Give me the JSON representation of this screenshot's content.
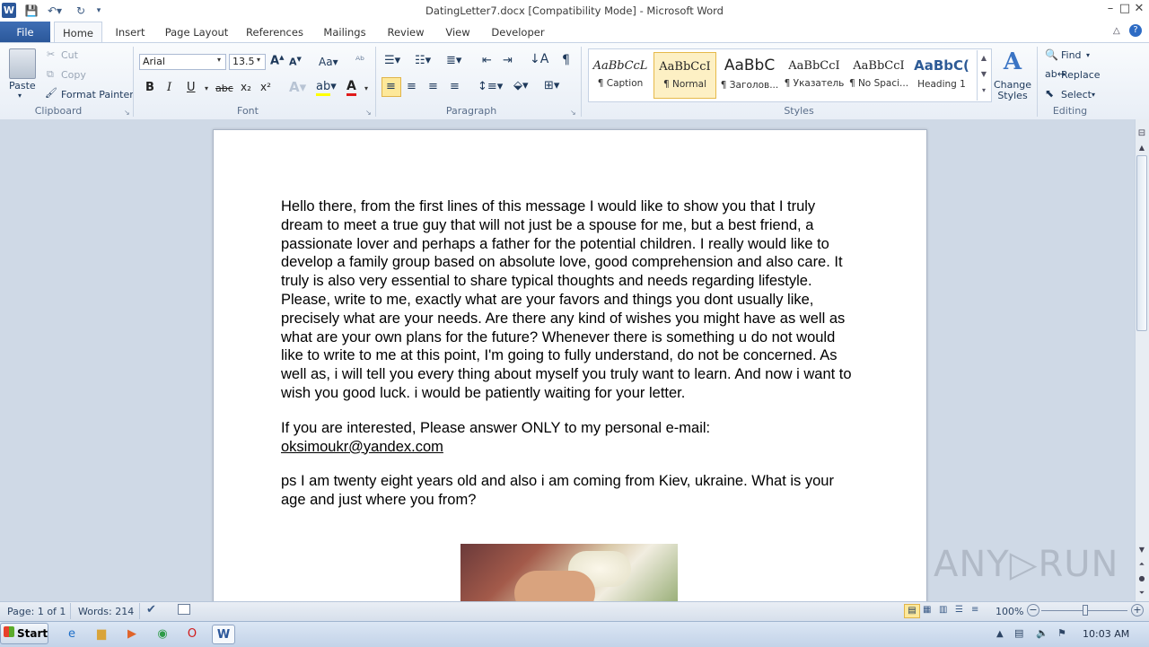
{
  "window": {
    "title": "DatingLetter7.docx [Compatibility Mode] - Microsoft Word",
    "controls": {
      "minimize": "–",
      "maximize": "□",
      "close": "✕"
    }
  },
  "tabs": [
    "File",
    "Home",
    "Insert",
    "Page Layout",
    "References",
    "Mailings",
    "Review",
    "View",
    "Developer"
  ],
  "ribbon": {
    "clipboard": {
      "paste": "Paste",
      "cut": "Cut",
      "copy": "Copy",
      "format_painter": "Format Painter",
      "label": "Clipboard"
    },
    "font": {
      "name": "Arial",
      "size": "13.5",
      "label": "Font",
      "bold": "B",
      "italic": "I",
      "underline": "U",
      "strike": "abc",
      "subscript": "x₂",
      "superscript": "x²",
      "font_color": "A"
    },
    "paragraph": {
      "label": "Paragraph",
      "pilcrow": "¶"
    },
    "styles": {
      "label": "Styles",
      "items": [
        {
          "sample": "AaBbCcL",
          "name": "¶ Caption"
        },
        {
          "sample": "AaBbCcI",
          "name": "¶ Normal"
        },
        {
          "sample": "AaBbC",
          "name": "¶ Заголов..."
        },
        {
          "sample": "AaBbCcI",
          "name": "¶ Указатель"
        },
        {
          "sample": "AaBbCcI",
          "name": "¶ No Spaci..."
        },
        {
          "sample": "AaBbC(",
          "name": "Heading 1"
        }
      ],
      "change_styles": "Change Styles"
    },
    "editing": {
      "label": "Editing",
      "find": "Find",
      "replace": "Replace",
      "select": "Select"
    }
  },
  "document": {
    "paragraph1": "Hello there, from the first lines of this message I would like to show you that I truly dream to meet a true guy that will not just be a spouse for me, but a best friend, a passionate lover and perhaps a father for the potential children. I really would like to develop a family group based on absolute love, good comprehension and also care. It truly is also very essential to share typical thoughts and needs regarding lifestyle. Please, write to me, exactly what are your favors and things you dont usually like, precisely what are your needs. Are there any kind of wishes you might have as well as what are your own plans for the future? Whenever there is something u do not would like to write to me at this point, I'm going to fully understand, do not be concerned. As well as, i will tell you every thing about myself you truly want to learn. And now i want to wish you good luck. i would be patiently waiting for your letter.",
    "paragraph2_prefix": "If you are interested, Please answer ONLY to my personal e-mail: ",
    "email": "oksimoukr@yandex.com",
    "paragraph3": "ps I am twenty eight years old and also i am coming from Kiev, ukraine. What is your age and just where you from?"
  },
  "statusbar": {
    "page": "Page: 1 of 1",
    "words": "Words: 214",
    "zoom": "100%",
    "zoom_minus": "−",
    "zoom_plus": "+"
  },
  "taskbar": {
    "start": "Start",
    "time": "10:03 AM"
  },
  "watermark": "ANY▷RUN"
}
